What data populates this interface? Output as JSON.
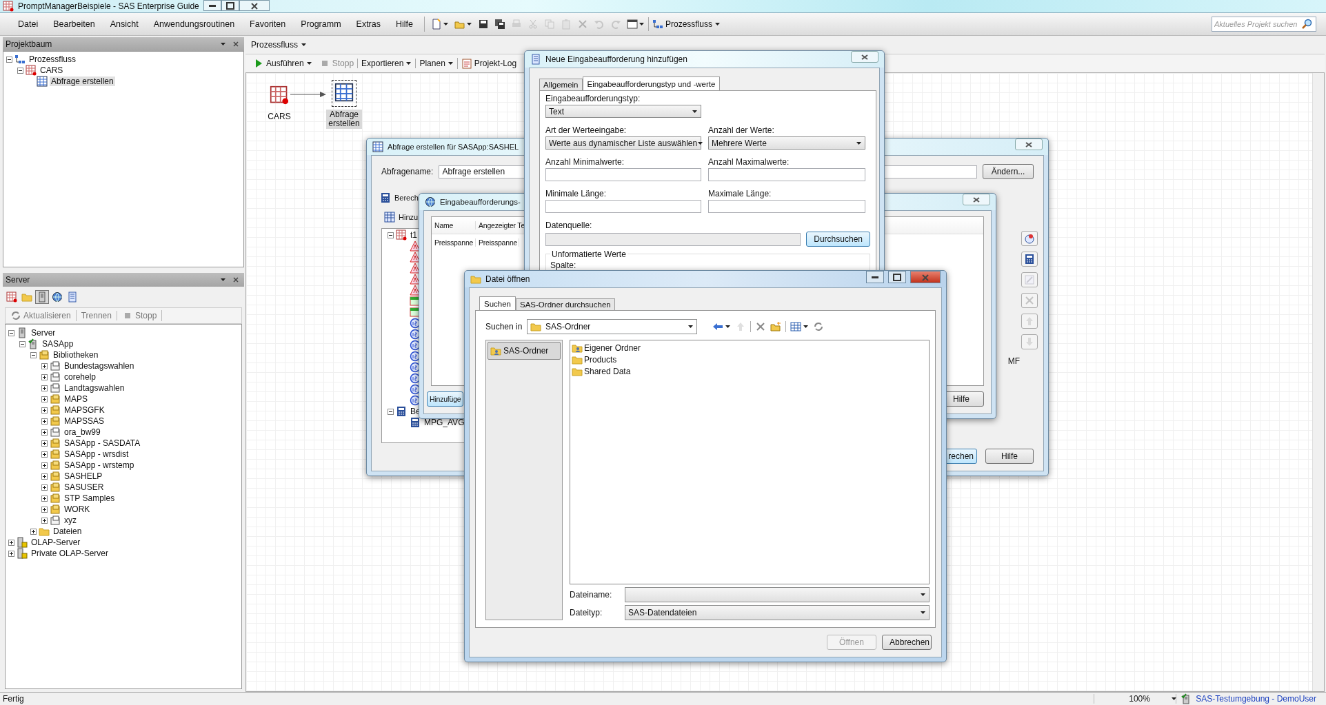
{
  "window": {
    "title": "PromptManagerBeispiele - SAS Enterprise Guide"
  },
  "menu": [
    "Datei",
    "Bearbeiten",
    "Ansicht",
    "Anwendungsroutinen",
    "Favoriten",
    "Programm",
    "Extras",
    "Hilfe"
  ],
  "toolbar": {
    "tools": [
      {
        "kind": "new",
        "dropdown": true,
        "disabled": false
      },
      {
        "kind": "open",
        "dropdown": true,
        "disabled": false
      },
      {
        "kind": "save",
        "disabled": false
      },
      {
        "kind": "save-all",
        "disabled": false
      },
      {
        "kind": "print",
        "disabled": true
      },
      {
        "kind": "cut",
        "disabled": true
      },
      {
        "kind": "copy",
        "disabled": true
      },
      {
        "kind": "paste",
        "disabled": true
      },
      {
        "kind": "delete",
        "disabled": true
      },
      {
        "kind": "undo",
        "disabled": true
      },
      {
        "kind": "redo",
        "disabled": true
      },
      {
        "kind": "window",
        "dropdown": true,
        "disabled": false
      }
    ],
    "flow_button": "Prozessfluss"
  },
  "search": {
    "placeholder": "Aktuelles Projekt suchen"
  },
  "project_tree": {
    "title": "Projektbaum",
    "items": [
      {
        "label": "Prozessfluss",
        "kind": "flow",
        "expanded": true,
        "selected": false,
        "children": [
          {
            "label": "CARS",
            "kind": "data",
            "expanded": true,
            "selected": false,
            "children": [
              {
                "label": "Abfrage erstellen",
                "kind": "query",
                "selected": true
              }
            ]
          }
        ]
      }
    ]
  },
  "server_panel": {
    "title": "Server",
    "tools": [
      {
        "kind": "data",
        "selected": false
      },
      {
        "kind": "folder",
        "selected": false
      },
      {
        "kind": "server",
        "selected": true
      },
      {
        "kind": "globe",
        "selected": false
      },
      {
        "kind": "book",
        "selected": false
      }
    ],
    "actions": [
      {
        "label": "Aktualisieren",
        "kind": "refresh",
        "disabled": true
      },
      {
        "label": "Trennen",
        "kind": "plain",
        "disabled": true
      },
      {
        "label": "Stopp",
        "kind": "stop",
        "disabled": true
      }
    ],
    "items": [
      {
        "label": "Server",
        "kind": "server",
        "expanded": true,
        "selected": false,
        "children": [
          {
            "label": "SASApp",
            "kind": "app",
            "expanded": true,
            "selected": false,
            "children": [
              {
                "label": "Bibliotheken",
                "kind": "library",
                "expanded": true,
                "selected": false,
                "children": [
                  {
                    "label": "Bundestagswahlen",
                    "kind": "library-remote",
                    "expanded": false,
                    "selected": false
                  },
                  {
                    "label": "corehelp",
                    "kind": "library-remote",
                    "expanded": false,
                    "selected": false
                  },
                  {
                    "label": "Landtagswahlen",
                    "kind": "library-remote",
                    "expanded": false,
                    "selected": false
                  },
                  {
                    "label": "MAPS",
                    "kind": "library",
                    "expanded": false,
                    "selected": false
                  },
                  {
                    "label": "MAPSGFK",
                    "kind": "library",
                    "expanded": false,
                    "selected": false
                  },
                  {
                    "label": "MAPSSAS",
                    "kind": "library",
                    "expanded": false,
                    "selected": false
                  },
                  {
                    "label": "ora_bw99",
                    "kind": "library-remote",
                    "expanded": false,
                    "selected": false
                  },
                  {
                    "label": "SASApp - SASDATA",
                    "kind": "library",
                    "expanded": false,
                    "selected": false
                  },
                  {
                    "label": "SASApp - wrsdist",
                    "kind": "library",
                    "expanded": false,
                    "selected": false
                  },
                  {
                    "label": "SASApp - wrstemp",
                    "kind": "library",
                    "expanded": false,
                    "selected": false
                  },
                  {
                    "label": "SASHELP",
                    "kind": "library",
                    "expanded": false,
                    "selected": false
                  },
                  {
                    "label": "SASUSER",
                    "kind": "library",
                    "expanded": false,
                    "selected": false
                  },
                  {
                    "label": "STP Samples",
                    "kind": "library",
                    "expanded": false,
                    "selected": false
                  },
                  {
                    "label": "WORK",
                    "kind": "library",
                    "expanded": false,
                    "selected": false
                  },
                  {
                    "label": "xyz",
                    "kind": "library-remote",
                    "expanded": false,
                    "selected": false
                  }
                ]
              },
              {
                "label": "Dateien",
                "kind": "folder",
                "expanded": false,
                "selected": false
              }
            ]
          }
        ]
      },
      {
        "label": "OLAP-Server",
        "kind": "olap",
        "expanded": false,
        "selected": false
      },
      {
        "label": "Private OLAP-Server",
        "kind": "olap",
        "expanded": false,
        "selected": false
      }
    ]
  },
  "flow": {
    "title": "Prozessfluss",
    "toolbar": [
      {
        "label": "Ausführen",
        "kind": "run",
        "dropdown": true,
        "disabled": false
      },
      {
        "label": "Stopp",
        "kind": "stop",
        "dropdown": false,
        "disabled": true
      },
      {
        "label": "Exportieren",
        "kind": "plain",
        "dropdown": true,
        "disabled": false
      },
      {
        "label": "Planen",
        "kind": "plain",
        "dropdown": true,
        "disabled": false
      },
      {
        "label": "Projekt-Log",
        "kind": "log",
        "dropdown": false,
        "disabled": false
      }
    ],
    "nodes": [
      {
        "label": "CARS",
        "kind": "data",
        "selected": false
      },
      {
        "label": "Abfrage erstellen",
        "kind": "query",
        "selected": true
      }
    ]
  },
  "query_dialog": {
    "title": "Abfrage erstellen für SASApp:SASHEL",
    "name_label": "Abfragename:",
    "name_value": "Abfrage erstellen",
    "change_button": "Ändern...",
    "section_1": "Berech",
    "section_2": "Hinzu",
    "tree_root": "t1",
    "columns": [
      {
        "kind": "char"
      },
      {
        "kind": "char"
      },
      {
        "kind": "char"
      },
      {
        "kind": "char"
      },
      {
        "kind": "char"
      },
      {
        "kind": "calc"
      },
      {
        "kind": "calc"
      },
      {
        "kind": "num"
      },
      {
        "kind": "num"
      },
      {
        "kind": "num"
      },
      {
        "kind": "num"
      },
      {
        "kind": "num"
      },
      {
        "kind": "num"
      },
      {
        "kind": "num"
      },
      {
        "kind": "num"
      }
    ],
    "group": "Be",
    "group_child": "MPG_AVG",
    "side_tools": [
      {
        "kind": "prompt",
        "disabled": false
      },
      {
        "kind": "calc",
        "disabled": false
      },
      {
        "kind": "edit",
        "disabled": true
      },
      {
        "kind": "delete",
        "disabled": true
      },
      {
        "kind": "up",
        "disabled": true
      },
      {
        "kind": "down",
        "disabled": true
      }
    ],
    "fragment": "MF",
    "buttons": [
      "rechen",
      "Hilfe"
    ]
  },
  "prompt_manager_dialog": {
    "title": "Eingabeaufforderungs-",
    "columns": [
      "Name",
      "Angezeigter Te"
    ],
    "rows": [
      [
        "Preisspanne",
        "Preisspanne"
      ]
    ],
    "buttons": [
      "Hinzufüge",
      "Hilfe"
    ]
  },
  "new_prompt_dialog": {
    "title": "Neue Eingabeaufforderung hinzufügen",
    "tabs": [
      {
        "label": "Allgemein",
        "selected": false
      },
      {
        "label": "Eingabeaufforderungstyp und -werte",
        "selected": true
      }
    ],
    "rows": [
      [
        {
          "label": "Eingabeaufforderungstyp:",
          "kind": "select",
          "value": "Text"
        }
      ],
      [
        {
          "label": "Art der Werteeingabe:",
          "kind": "select",
          "value": "Werte aus dynamischer Liste auswählen"
        },
        {
          "label": "Anzahl der Werte:",
          "kind": "select",
          "value": "Mehrere Werte"
        }
      ],
      [
        {
          "label": "Anzahl Minimalwerte:",
          "kind": "text"
        },
        {
          "label": "Anzahl Maximalwerte:",
          "kind": "text"
        }
      ],
      [
        {
          "label": "Minimale Länge:",
          "kind": "text"
        },
        {
          "label": "Maximale Länge:",
          "kind": "text"
        }
      ]
    ],
    "data_source": {
      "label": "Datenquelle:",
      "disabled": true,
      "button": "Durchsuchen"
    },
    "group": {
      "title": "Unformatierte Werte",
      "label": "Spalte:"
    }
  },
  "open_dialog": {
    "title": "Datei öffnen",
    "tabs": [
      {
        "label": "Suchen",
        "selected": true
      },
      {
        "label": "SAS-Ordner durchsuchen",
        "selected": false
      }
    ],
    "look_in_label": "Suchen in",
    "look_in_value": "SAS-Ordner",
    "tools": [
      {
        "kind": "back",
        "disabled": false
      },
      {
        "kind": "up",
        "disabled": true
      },
      {
        "kind": "delete",
        "disabled": false
      },
      {
        "kind": "new-folder",
        "disabled": false
      },
      {
        "kind": "views",
        "disabled": false
      },
      {
        "kind": "refresh",
        "disabled": false
      }
    ],
    "places": [
      {
        "label": "SAS-Ordner",
        "selected": true
      }
    ],
    "files": [
      {
        "label": "Eigener Ordner",
        "kind": "user-folder"
      },
      {
        "label": "Products",
        "kind": "folder"
      },
      {
        "label": "Shared Data",
        "kind": "folder"
      }
    ],
    "filename_label": "Dateiname:",
    "filetype_label": "Dateityp:",
    "filetype_value": "SAS-Datendateien",
    "buttons": [
      {
        "label": "Öffnen",
        "disabled": true
      },
      {
        "label": "Abbrechen",
        "disabled": false
      }
    ]
  },
  "status_bar": {
    "text": "Fertig",
    "zoom": "100%",
    "server": "SAS-Testumgebung - DemoUser"
  }
}
